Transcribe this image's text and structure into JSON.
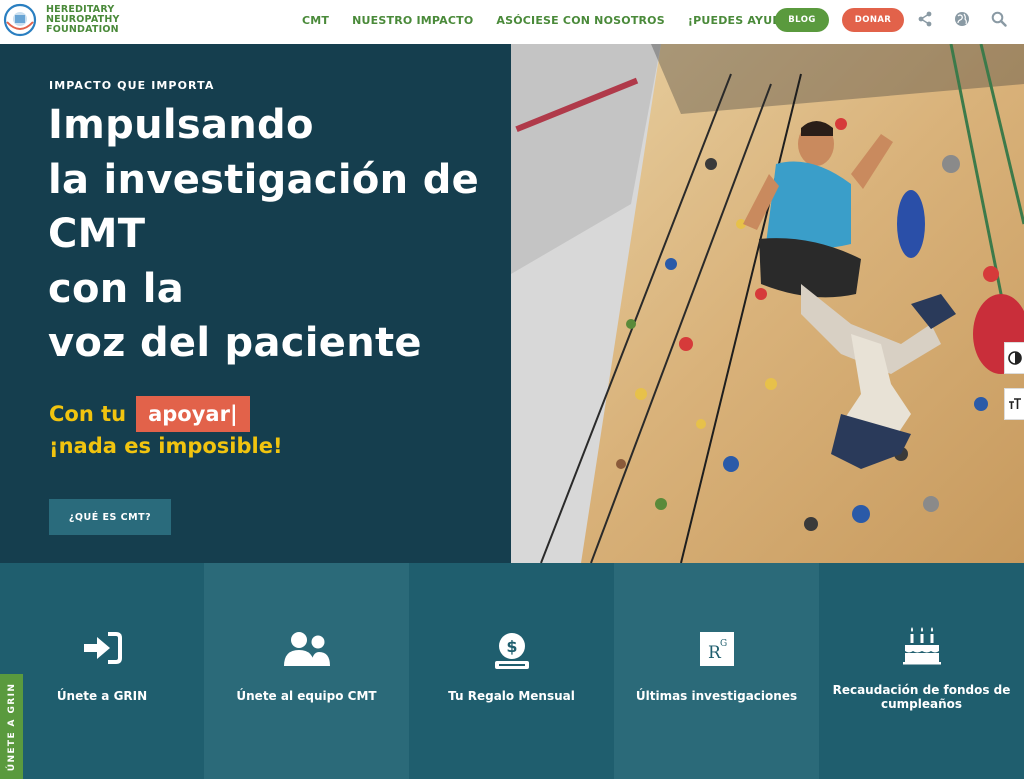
{
  "brand": {
    "line1": "HEREDITARY",
    "line2": "NEUROPATHY",
    "line3": "FOUNDATION",
    "color": "#4a8a3a"
  },
  "nav": {
    "items": [
      {
        "label": "CMT"
      },
      {
        "label": "NUESTRO IMPACTO"
      },
      {
        "label": "ASÓCIESE CON NOSOTROS"
      },
      {
        "label": "¡PUEDES AYUDAR!"
      }
    ],
    "blog_label": "BLOG",
    "donate_label": "DONAR",
    "icons": [
      "share-icon",
      "globe-icon",
      "search-icon"
    ]
  },
  "hero": {
    "eyebrow": "IMPACTO QUE IMPORTA",
    "headline": [
      "Impulsando",
      "la investigación de",
      "CMT",
      "con la",
      "voz del paciente"
    ],
    "tagline_prefix": "Con tu",
    "tagline_typed": "apoyar|",
    "tagline_suffix": "¡nada es imposible!",
    "cta_label": "¿QUÉ ES CMT?",
    "image": "rock-climbing-wall-photo"
  },
  "tools": [
    "contrast-icon",
    "text-size-icon"
  ],
  "tiles": [
    {
      "label": "Únete a GRIN",
      "icon": "sign-in-icon",
      "color": "#1f5e6e"
    },
    {
      "label": "Únete al equipo CMT",
      "icon": "users-icon",
      "color": "#2b6a79"
    },
    {
      "label": "Tu Regalo Mensual",
      "icon": "donation-icon",
      "color": "#1f5e6e"
    },
    {
      "label": "Últimas investigaciones",
      "icon": "research-gate-icon",
      "color": "#2b6a79"
    },
    {
      "label": "Recaudación de fondos de cumpleaños",
      "icon": "birthday-cake-icon",
      "color": "#1f5e6e"
    }
  ],
  "side_tab": {
    "label": "ÚNETE A GRIN"
  },
  "colors": {
    "hero_bg": "#153e4e",
    "accent_orange": "#e2624a",
    "accent_yellow": "#f1c40f",
    "green": "#5a9a3e"
  }
}
